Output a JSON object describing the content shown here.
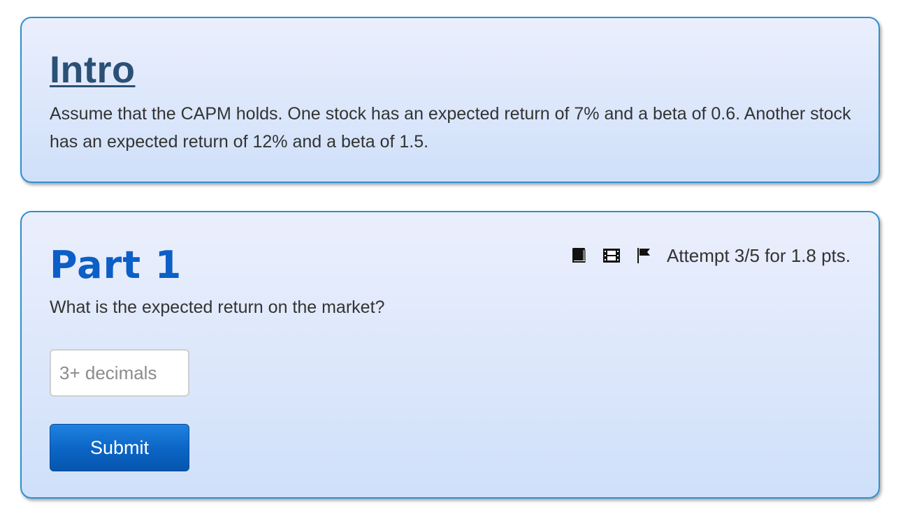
{
  "intro": {
    "title": "Intro",
    "text": "Assume that the CAPM holds. One stock has an expected return of 7% and a beta of 0.6. Another stock has an expected return of 12% and a beta of 1.5."
  },
  "part": {
    "title": "Part 1",
    "tools": {
      "book_icon": "book-icon",
      "video_icon": "film-icon",
      "flag_icon": "flag-icon"
    },
    "attempt": "Attempt 3/5 for 1.8 pts.",
    "question": "What is the expected return on the market?",
    "answer": {
      "value": "",
      "placeholder": "3+ decimals"
    },
    "submit_label": "Submit"
  },
  "colors": {
    "card_border": "#2f8fd0",
    "intro_title": "#2a5075",
    "part_title": "#0b5fc6",
    "button": "#0b64c4"
  }
}
